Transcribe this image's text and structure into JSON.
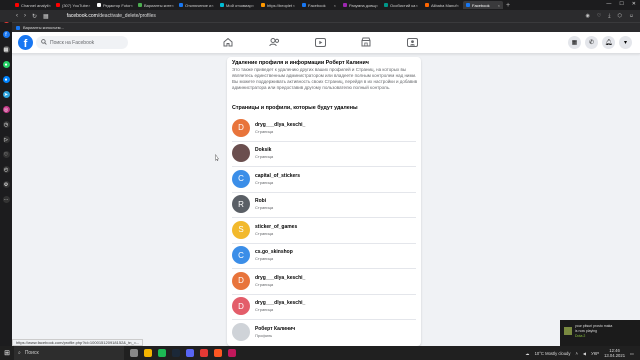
{
  "browser": {
    "tabs": [
      {
        "label": "Channel analyti",
        "color": "#ff0000"
      },
      {
        "label": "(307) YouTube",
        "color": "#ff0000"
      },
      {
        "label": "Редактор Fotor",
        "color": "#ffffff"
      },
      {
        "label": "Варианты ките",
        "color": "#4caf50"
      },
      {
        "label": "Отключение и",
        "color": "#1877f2"
      },
      {
        "label": "Мой отзовиар",
        "color": "#00bcd4"
      },
      {
        "label": "https://beoplet",
        "color": "#ff9800"
      },
      {
        "label": "Facebook",
        "color": "#1877f2"
      },
      {
        "label": "Разумна довщ",
        "color": "#9c27b0"
      },
      {
        "label": "Особистий ка",
        "color": "#009688"
      },
      {
        "label": "Alibaba Manuf",
        "color": "#ff6600"
      },
      {
        "label": "Facebook",
        "color": "#1877f2",
        "active": true
      }
    ],
    "url_domain": "facebook.com",
    "url_path": "/deactivate_delete/profiles",
    "bookmark": "Варианты киносъем..."
  },
  "facebook": {
    "logo_letter": "f",
    "search_placeholder": "Поиск на Facebook"
  },
  "card": {
    "title": "Удаление профиля и информации Роберт Калинич",
    "description": "Это также приведет к удалению других ваших профилей и Страниц, на которых вы являетесь единственным администратором или владеете полным контролем над ними. Вы можете поддерживать активность своих Страниц, перейдя в их настройки и добавив администратора или предоставив другому пользователю полный контроль.",
    "subtitle": "Страницы и профили, которые будут удалены",
    "items": [
      {
        "initial": "D",
        "name": "dryg___dlya_keschi_",
        "type": "Страница",
        "color": "#e8743b"
      },
      {
        "initial": "",
        "name": "Doksik",
        "type": "Страница",
        "color": "#6b4f4f"
      },
      {
        "initial": "C",
        "name": "capital_of_stickers",
        "type": "Страница",
        "color": "#3b8ee8"
      },
      {
        "initial": "R",
        "name": "Robi",
        "type": "Страница",
        "color": "#5a5f66"
      },
      {
        "initial": "S",
        "name": "sticker_of_games",
        "type": "Страница",
        "color": "#f2b92c"
      },
      {
        "initial": "C",
        "name": "cs.go_skinshop",
        "type": "Страница",
        "color": "#3b8ee8"
      },
      {
        "initial": "D",
        "name": "dryg___dlya_keschi_",
        "type": "Страница",
        "color": "#e8743b"
      },
      {
        "initial": "D",
        "name": "dryg___dlya_keschi_",
        "type": "Страница",
        "color": "#e35d6a"
      },
      {
        "initial": "",
        "name": "Роберт Калинич",
        "type": "Профиль",
        "color": "#cfd3d8"
      }
    ]
  },
  "status_url": "https://www.facebook.com/profile.php?id=100015120918152&_tn_=...",
  "notification": {
    "line1": "your pitsuri prosto maka",
    "line2": "is now playing",
    "line3": "Dota 2"
  },
  "taskbar": {
    "search_label": "Поиск",
    "weather": "10°C  Mostly cloudy",
    "lang": "УКР",
    "time": "12:46",
    "date": "13.04.2021"
  }
}
